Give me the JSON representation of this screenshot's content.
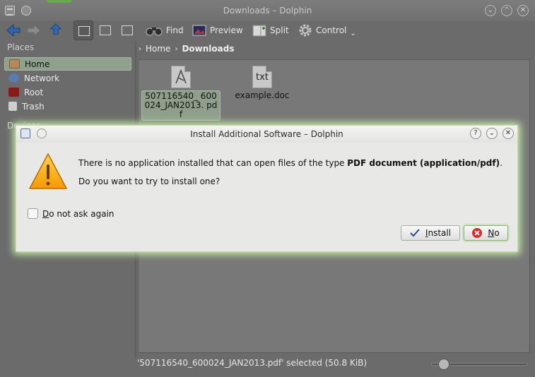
{
  "window": {
    "title": "Downloads – Dolphin"
  },
  "toolbar": {
    "find": "Find",
    "preview": "Preview",
    "split": "Split",
    "control": "Control"
  },
  "places": {
    "title": "Places",
    "items": [
      {
        "label": "Home",
        "selected": true
      },
      {
        "label": "Network"
      },
      {
        "label": "Root"
      },
      {
        "label": "Trash"
      }
    ],
    "devices_title": "Devices"
  },
  "breadcrumb": {
    "home": "Home",
    "current": "Downloads"
  },
  "files": [
    {
      "name": "507116540_ 600024_JAN2013. pdf",
      "icon": "pdf-file-icon",
      "selected": true
    },
    {
      "name": "example.doc",
      "icon": "txt-file-icon",
      "icon_text": "txt"
    }
  ],
  "statusbar": {
    "text": "'507116540_600024_JAN2013.pdf' selected (50.8 KiB)"
  },
  "dialog": {
    "title": "Install Additional Software – Dolphin",
    "message_prefix": "There is no application installed that can open files of the type ",
    "message_type": "PDF document (application/pdf)",
    "message_suffix": ".",
    "question": "Do you want to try to install one?",
    "checkbox_rest": "o not ask again",
    "checkbox_mnemonic": "D",
    "install_mnemonic": "I",
    "install_rest": "nstall",
    "no_mnemonic": "N",
    "no_rest": "o"
  },
  "colors": {
    "dialog_glow": "#c8f0a8",
    "warning": "#f5a800",
    "no_icon": "#d62c2c"
  }
}
